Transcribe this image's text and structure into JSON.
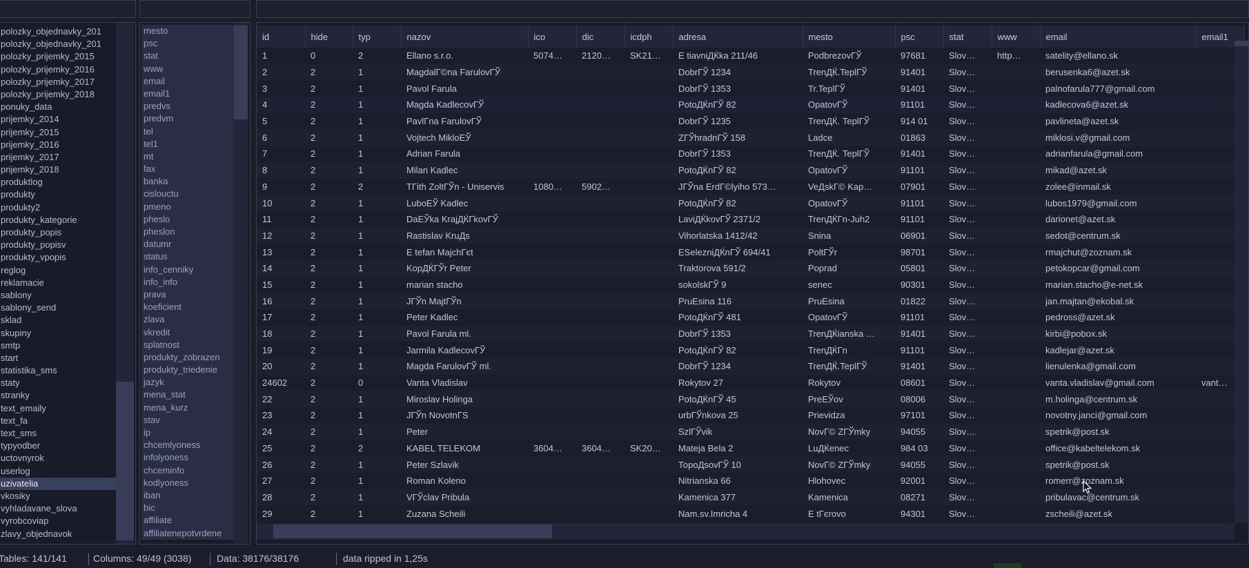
{
  "tables": {
    "items": [
      "polozky_objednavky_201",
      "polozky_objednavky_201",
      "polozky_prijemky_2015",
      "polozky_prijemky_2016",
      "polozky_prijemky_2017",
      "polozky_prijemky_2018",
      "ponuky_data",
      "prijemky_2014",
      "prijemky_2015",
      "prijemky_2016",
      "prijemky_2017",
      "prijemky_2018",
      "produktlog",
      "produkty",
      "produkty2",
      "produkty_kategorie",
      "produkty_popis",
      "produkty_popisv",
      "produkty_vpopis",
      "reglog",
      "reklamacie",
      "sablony",
      "sablony_send",
      "sklad",
      "skupiny",
      "smtp",
      "start",
      "statistika_sms",
      "staty",
      "stranky",
      "text_emaily",
      "text_fa",
      "text_sms",
      "typyodber",
      "uctovnyrok",
      "userlog",
      "uzivatelia",
      "vkosiky",
      "vyhladavane_slova",
      "vyrobcoviap",
      "zlavy_objednavok"
    ],
    "selected_index": 36
  },
  "columns": {
    "items": [
      "mesto",
      "psc",
      "stat",
      "www",
      "email",
      "email1",
      "predvs",
      "predvm",
      "tel",
      "tel1",
      "mt",
      "fax",
      "banka",
      "cislouctu",
      "pmeno",
      "pheslo",
      "pheslon",
      "datumr",
      "status",
      "info_cenniky",
      "info_info",
      "prava",
      "koeficient",
      "zlava",
      "vkredit",
      "splatnost",
      "produkty_zobrazen",
      "produkty_triedenie",
      "jazyk",
      "mena_stat",
      "mena_kurz",
      "stav",
      "ip",
      "chcemlyoness",
      "infolyoness",
      "chceminfo",
      "kodlyoness",
      "iban",
      "bic",
      "affiliate",
      "affiliatenepotvrdene"
    ]
  },
  "grid": {
    "headers": [
      "id",
      "hide",
      "typ",
      "nazov",
      "ico",
      "dic",
      "icdph",
      "adresa",
      "mesto",
      "psc",
      "stat",
      "www",
      "email",
      "email1"
    ],
    "rows": [
      [
        "1",
        "0",
        "2",
        "Ellano s.r.o.",
        "5074…",
        "2120…",
        "SK21…",
        "E tiavniДЌka 211/46",
        "PodbrezovГЎ",
        "97681",
        "Slov…",
        "http…",
        "satelity@ellano.sk",
        ""
      ],
      [
        "2",
        "2",
        "1",
        "MagdalГ©na FarulovГЎ",
        "",
        "",
        "",
        "DobrГЎ 1234",
        "TrenДЌ.TeplГЎ",
        "91401",
        "Slov…",
        "",
        "berusenka6@azet.sk",
        ""
      ],
      [
        "3",
        "2",
        "1",
        "Pavol Farula",
        "",
        "",
        "",
        "DobrГЎ 1353",
        "Tr.TeplГЎ",
        "91401",
        "Slov…",
        "",
        "palnofarula777@gmail.com",
        ""
      ],
      [
        "4",
        "2",
        "1",
        "Magda KadlecovГЎ",
        "",
        "",
        "",
        "PotoДЌnГЎ 82",
        "OpatovГЎ",
        "91101",
        "Slov…",
        "",
        "kadlecova6@azet.sk",
        ""
      ],
      [
        "5",
        "2",
        "1",
        "PavlГ­na FarulovГЎ",
        "",
        "",
        "",
        "DobrГЎ 1235",
        "TrenДЌ. TeplГЎ",
        "914 01",
        "Slov…",
        "",
        "pavlineta@azet.sk",
        ""
      ],
      [
        "6",
        "2",
        "1",
        "Vojtech MikloЕЎ",
        "",
        "",
        "",
        "ZГЎhradnГЎ 158",
        "Ladce",
        "01863",
        "Slov…",
        "",
        "miklosi.v@gmail.com",
        ""
      ],
      [
        "7",
        "2",
        "1",
        "Adrian Farula",
        "",
        "",
        "",
        "DobrГЎ 1353",
        "TrenДЌ. TeplГЎ",
        "91401",
        "Slov…",
        "",
        "adrianfarula@gmail.com",
        ""
      ],
      [
        "8",
        "2",
        "1",
        "Milan Kadlec",
        "",
        "",
        "",
        "PotoДЌnГЎ 82",
        "OpatovГЎ",
        "91101",
        "Slov…",
        "",
        "mikad@azet.sk",
        ""
      ],
      [
        "9",
        "2",
        "2",
        "TГіth ZoltГЎn - Uniservis",
        "1080…",
        "5902…",
        "",
        "JГЎna ErdГ©lyiho 573…",
        "VeДѕkГ© Kap…",
        "07901",
        "Slov…",
        "",
        "zolee@inmail.sk",
        ""
      ],
      [
        "10",
        "2",
        "1",
        "LuboЕЎ Kadlec",
        "",
        "",
        "",
        "PotoДЌnГЎ 82",
        "OpatovГЎ",
        "91101",
        "Slov…",
        "",
        "lubos1979@gmail.com",
        ""
      ],
      [
        "11",
        "2",
        "1",
        "DaЕЎka KrajДЌГ­kovГЎ",
        "",
        "",
        "",
        "LaviДЌkovГЎ 2371/2",
        "TrenДЌГ­n-Juh2",
        "91101",
        "Slov…",
        "",
        "darionet@azet.sk",
        ""
      ],
      [
        "12",
        "2",
        "1",
        "Rastislav KruДѕ",
        "",
        "",
        "",
        "Vihorlatska 1412/42",
        "Snina",
        "06901",
        "Slov…",
        "",
        "sedot@centrum.sk",
        ""
      ],
      [
        "13",
        "2",
        "1",
        "E tefan MajchГєt",
        "",
        "",
        "",
        "ESelezniДЌnГЎ 694/41",
        "PoltГЎr",
        "98701",
        "Slov…",
        "",
        "rmajchut@zoznam.sk",
        ""
      ],
      [
        "14",
        "2",
        "1",
        "KopДЌГЎr Peter",
        "",
        "",
        "",
        "Traktorova 591/2",
        "Poprad",
        "05801",
        "Slov…",
        "",
        "petokopcar@gmail.com",
        ""
      ],
      [
        "15",
        "2",
        "1",
        "marian stacho",
        "",
        "",
        "",
        "sokolskГЎ 9",
        "senec",
        "90301",
        "Slov…",
        "",
        "marian.stacho@e-net.sk",
        ""
      ],
      [
        "16",
        "2",
        "1",
        "JГЎn MajtГЎn",
        "",
        "",
        "",
        "PruEsina 116",
        "PruEsina",
        "01822",
        "Slov…",
        "",
        "jan.majtan@ekobal.sk",
        ""
      ],
      [
        "17",
        "2",
        "1",
        "Peter Kadlec",
        "",
        "",
        "",
        "PotoДЌnГЎ 481",
        "OpatovГЎ",
        "91101",
        "Slov…",
        "",
        "pedross@azet.sk",
        ""
      ],
      [
        "18",
        "2",
        "1",
        "Pavol Farula ml.",
        "",
        "",
        "",
        "DobrГЎ 1353",
        "TrenДЌianska …",
        "91401",
        "Slov…",
        "",
        "kirbi@pobox.sk",
        ""
      ],
      [
        "19",
        "2",
        "1",
        "Jarmila KadlecovГЎ",
        "",
        "",
        "",
        "PotoДЌnГЎ 82",
        "TrenДЌГ­n",
        "91101",
        "Slov…",
        "",
        "kadlejar@azet.sk",
        ""
      ],
      [
        "20",
        "2",
        "1",
        "Magda FarulovГЎ ml.",
        "",
        "",
        "",
        "DobrГЎ 1234",
        "TrenДЌ.TeplГЎ",
        "91401",
        "Slov…",
        "",
        "lienulenka@gmail.com",
        ""
      ],
      [
        "24602",
        "2",
        "0",
        "Vanta Vladislav",
        "",
        "",
        "",
        "Rokytov 27",
        "Rokytov",
        "08601",
        "Slov…",
        "",
        "vanta.vladislav@gmail.com",
        "vant…"
      ],
      [
        "22",
        "2",
        "1",
        "Miroslav Holinga",
        "",
        "",
        "",
        "PotoДЌnГЎ 45",
        "PreЕЎov",
        "08006",
        "Slov…",
        "",
        "m.holinga@centrum.sk",
        ""
      ],
      [
        "23",
        "2",
        "1",
        "JГЎn NovotnГЅ",
        "",
        "",
        "",
        "urbГЎnkova 25",
        "Prievidza",
        "97101",
        "Slov…",
        "",
        "novotny.janci@gmail.com",
        ""
      ],
      [
        "24",
        "2",
        "1",
        "Peter",
        "",
        "",
        "",
        "SzlГЎvik",
        "NovГ© ZГЎmky",
        "94055",
        "Slov…",
        "",
        "spetrik@post.sk",
        ""
      ],
      [
        "25",
        "2",
        "2",
        "KABEL TELEKOM",
        "3604…",
        "3604…",
        "SK20…",
        "Mateja Bela 2",
        "LuДЌenec",
        "984 03",
        "Slov…",
        "",
        "office@kabeltelekom.sk",
        ""
      ],
      [
        "26",
        "2",
        "1",
        "Peter Szlavik",
        "",
        "",
        "",
        "ТороДѕovГЎ 10",
        "NovГ© ZГЎmky",
        "94055",
        "Slov…",
        "",
        "spetrik@post.sk",
        ""
      ],
      [
        "27",
        "2",
        "1",
        "Roman Koleno",
        "",
        "",
        "",
        "Nitrianska 66",
        "Hlohovec",
        "92001",
        "Slov…",
        "",
        "romerr@zoznam.sk",
        ""
      ],
      [
        "28",
        "2",
        "1",
        "VГЎclav Pribula",
        "",
        "",
        "",
        "Kamenica 377",
        "Kamenica",
        "08271",
        "Slov…",
        "",
        "pribulavac@centrum.sk",
        ""
      ],
      [
        "29",
        "2",
        "1",
        "Zuzana Scheili",
        "",
        "",
        "",
        "Nam.sv.Imricha 4",
        "E tГєrovo",
        "94301",
        "Slov…",
        "",
        "zscheili@azet.sk",
        ""
      ]
    ]
  },
  "status": {
    "tables": "Tables: 141/141",
    "columns": "Columns: 49/49 (3038)",
    "data": "Data: 38176/38176",
    "message": "data ripped in 1,25s"
  }
}
